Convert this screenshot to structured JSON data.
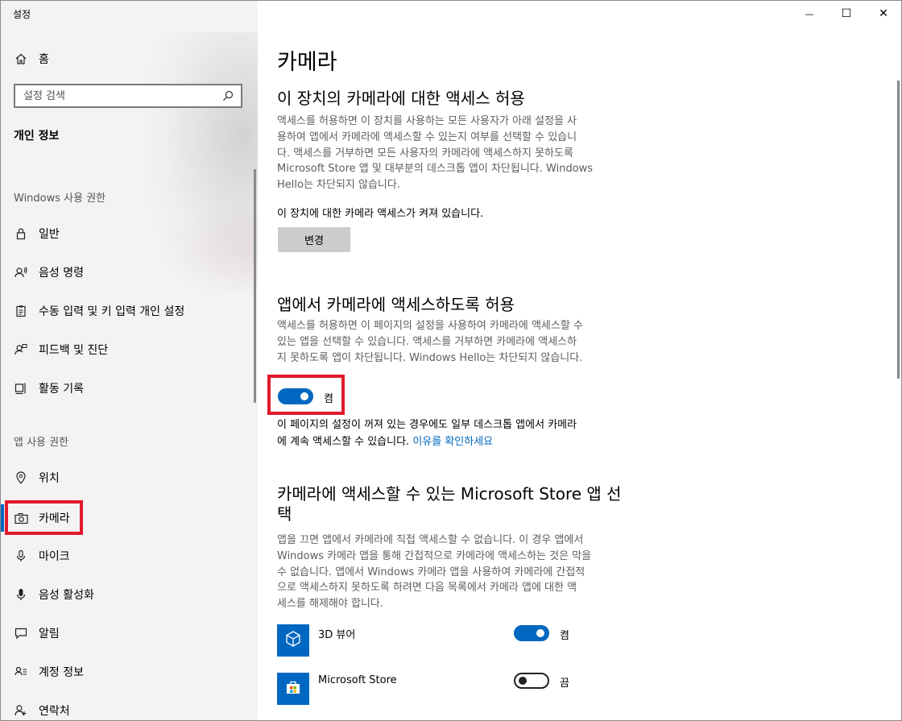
{
  "window": {
    "title": "설정",
    "minimize_glyph": "—",
    "maximize_glyph": "☐",
    "close_glyph": "✕"
  },
  "sidebar": {
    "home_label": "홈",
    "search_placeholder": "설정 검색",
    "section_title": "개인 정보",
    "windows_group": {
      "header": "Windows 사용 권한",
      "items": [
        {
          "label": "일반",
          "icon": "lock-icon"
        },
        {
          "label": "음성 명령",
          "icon": "speech-icon"
        },
        {
          "label": "수동 입력 및 키 입력 개인 설정",
          "icon": "clipboard-icon"
        },
        {
          "label": "피드백 및 진단",
          "icon": "feedback-icon"
        },
        {
          "label": "활동 기록",
          "icon": "timeline-icon"
        }
      ]
    },
    "app_group": {
      "header": "앱 사용 권한",
      "items": [
        {
          "label": "위치",
          "icon": "location-icon"
        },
        {
          "label": "카메라",
          "icon": "camera-icon",
          "selected": true
        },
        {
          "label": "마이크",
          "icon": "microphone-icon"
        },
        {
          "label": "음성 활성화",
          "icon": "voice-activation-icon"
        },
        {
          "label": "알림",
          "icon": "notification-icon"
        },
        {
          "label": "계정 정보",
          "icon": "account-info-icon"
        },
        {
          "label": "연락처",
          "icon": "contacts-icon"
        }
      ]
    }
  },
  "main": {
    "page_title": "카메라",
    "device_section": {
      "title": "이 장치의 카메라에 대한 액세스 허용",
      "description_lines": [
        "액세스를 허용하면 이 장치를 사용하는 모든 사용자가 아래 설정을 사",
        "용하여 앱에서 카메라에 액세스할 수 있는지 여부를 선택할 수 있습니",
        "다. 액세스를 거부하면 모든 사용자의 카메라에 액세스하지 못하도록",
        "Microsoft Store 앱 및 대부분의 데스크톱 앱이 차단됩니다. Windows",
        "Hello는 차단되지 않습니다."
      ],
      "status": "이 장치에 대한 카메라 액세스가 켜져 있습니다.",
      "change_button": "변경"
    },
    "apps_section": {
      "title": "앱에서 카메라에 액세스하도록 허용",
      "description_lines": [
        "액세스를 허용하면 이 페이지의 설정을 사용하여 카메라에 액세스할 수",
        "있는 앱을 선택할 수 있습니다. 액세스를 거부하면 카메라에 액세스하",
        "지 못하도록 앱이 차단됩니다. Windows Hello는 차단되지 않습니다."
      ],
      "toggle_state": "켬",
      "toggle_on": true,
      "note_line1": "이 페이지의 설정이 꺼져 있는 경우에도 일부 데스크톱 앱에서 카메라",
      "note_line2": "에 계속 액세스할 수 있습니다.",
      "note_link": "이유를 확인하세요"
    },
    "store_section": {
      "title_line1": "카메라에 액세스할 수 있는 Microsoft Store 앱 선",
      "title_line2": "택",
      "description_lines": [
        "앱을 끄면 앱에서 카메라에 직접 액세스할 수 없습니다. 이 경우 앱에서",
        "Windows 카메라 앱을 통해 간접적으로 카메라에 액세스하는 것은 막을",
        "수 없습니다. 앱에서 Windows 카메라 앱을 사용하여 카메라에 간접적",
        "으로 액세스하지 못하도록 하려면 다음 목록에서 카메라 앱에 대한 액",
        "세스를 해제해야 합니다."
      ],
      "apps": [
        {
          "name": "3D 뷰어",
          "state": "켬",
          "on": true,
          "icon": "3d-viewer-icon"
        },
        {
          "name": "Microsoft Store",
          "state": "끔",
          "on": false,
          "icon": "store-bag-icon"
        }
      ]
    }
  },
  "colors": {
    "accent": "#0067c0",
    "highlight_box": "#e2192c",
    "sidebar_bg": "#f3f3f3"
  }
}
